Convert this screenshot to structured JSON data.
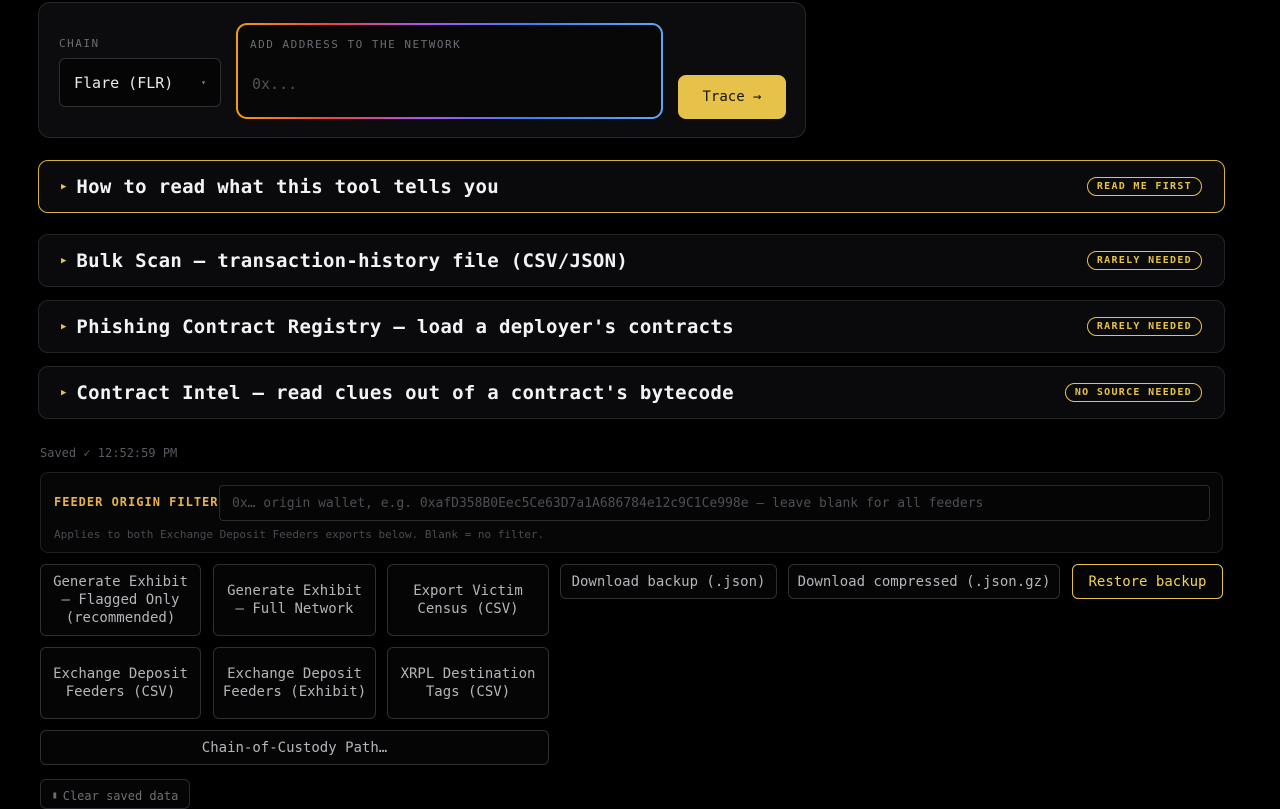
{
  "trace": {
    "chain_label": "CHAIN",
    "chain_value": "Flare (FLR)",
    "address_label": "ADD ADDRESS TO THE NETWORK",
    "address_placeholder": "0x...",
    "trace_button": "Trace →"
  },
  "accordions": [
    {
      "title": "How to read what this tool tells you",
      "badge": "READ ME FIRST"
    },
    {
      "title": "Bulk Scan — transaction-history file (CSV/JSON)",
      "badge": "RARELY NEEDED"
    },
    {
      "title": "Phishing Contract Registry — load a deployer's contracts",
      "badge": "RARELY NEEDED"
    },
    {
      "title": "Contract Intel — read clues out of a contract's bytecode",
      "badge": "NO SOURCE NEEDED"
    }
  ],
  "saved_status": "Saved ✓ 12:52:59 PM",
  "feeder_filter": {
    "label": "FEEDER ORIGIN FILTER",
    "placeholder": "0x… origin wallet, e.g. 0xafD358B0Eec5Ce63D7a1A686784e12c9C1Ce998e — leave blank for all feeders",
    "hint": "Applies to both Exchange Deposit Feeders exports below. Blank = no filter."
  },
  "exports": {
    "flagged_only": "Generate Exhibit — Flagged Only (recommended)",
    "full_network": "Generate Exhibit — Full Network",
    "victim_census": "Export Victim Census (CSV)",
    "deposit_feeders_csv": "Exchange Deposit Feeders (CSV)",
    "deposit_feeders_exhibit": "Exchange Deposit Feeders (Exhibit)",
    "xrpl_tags": "XRPL Destination Tags (CSV)",
    "custody_path": "Chain-of-Custody Path…"
  },
  "backup": {
    "download_json": "Download backup (.json)",
    "download_gz": "Download compressed (.json.gz)",
    "restore": "Restore backup"
  },
  "clear_saved": "Clear saved data",
  "icons": {
    "accordion_toggle": "triangle-right-icon",
    "clear": "trash-icon"
  },
  "colors": {
    "accent": "#e6c24a",
    "background": "#000000"
  }
}
